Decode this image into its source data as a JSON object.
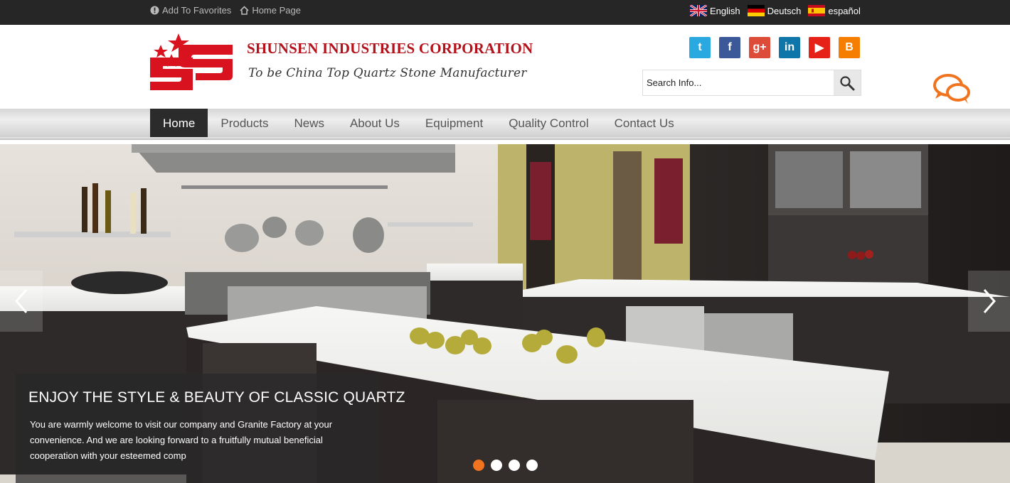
{
  "topbar": {
    "favorites": "Add To Favorites",
    "home": "Home Page",
    "languages": [
      {
        "label": "English",
        "flag": "uk-flag-icon"
      },
      {
        "label": "Deutsch",
        "flag": "de-flag-icon"
      },
      {
        "label": "español",
        "flag": "es-flag-icon"
      }
    ]
  },
  "header": {
    "company": "SHUNSEN INDUSTRIES CORPORATION",
    "slogan": "To be China Top Quartz Stone Manufacturer",
    "search_placeholder": "Search Info...",
    "social": [
      {
        "name": "twitter-icon",
        "glyph": "t",
        "color": "#2aa9e0"
      },
      {
        "name": "facebook-icon",
        "glyph": "f",
        "color": "#3b5998"
      },
      {
        "name": "google-plus-icon",
        "glyph": "g+",
        "color": "#dd4b39"
      },
      {
        "name": "linkedin-icon",
        "glyph": "in",
        "color": "#0e76a8"
      },
      {
        "name": "youtube-icon",
        "glyph": "▶",
        "color": "#e62117"
      },
      {
        "name": "blogger-icon",
        "glyph": "B",
        "color": "#f57d00"
      }
    ]
  },
  "nav": {
    "items": [
      "Home",
      "Products",
      "News",
      "About Us",
      "Equipment",
      "Quality Control",
      "Contact Us"
    ],
    "active": 0
  },
  "hero": {
    "title": "ENJOY THE STYLE & BEAUTY OF CLASSIC QUARTZ",
    "text": "You are warmly welcome to visit our company and  Granite Factory at your convenience. And we are looking forward to a  fruitfully mutual beneficial cooperation with your esteemed comp",
    "slides": 4,
    "active_slide": 0
  },
  "colors": {
    "brand_red": "#b4121b",
    "accent_orange": "#f0731f",
    "topbar": "#262626"
  }
}
